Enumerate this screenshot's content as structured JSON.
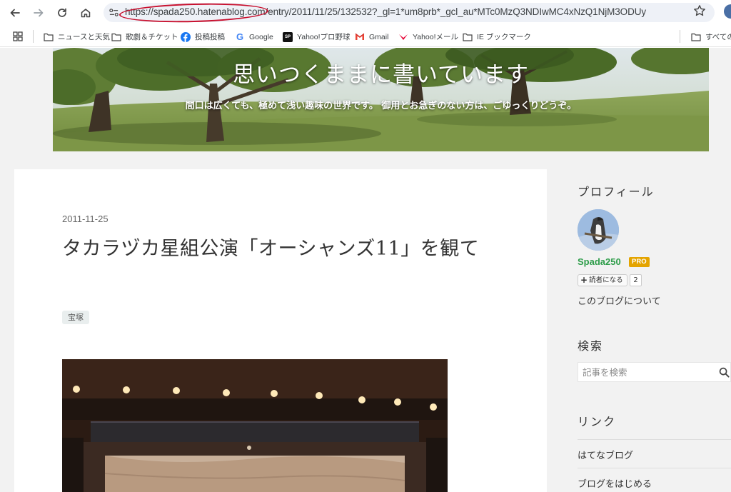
{
  "browser": {
    "url": "https://spada250.hatenablog.com/entry/2011/11/25/132532?_gl=1*um8prb*_gcl_au*MTc0MzQ3NDIwMC4xNzQ1NjM3ODUy",
    "icons": [
      "back-arrow-icon",
      "forward-arrow-icon",
      "reload-icon",
      "home-icon",
      "site-info-icon",
      "bookmark-star-icon"
    ],
    "annotation_color": "#c8102e"
  },
  "bookmarks": [
    {
      "label": "ニュースと天気",
      "icon": "folder-icon"
    },
    {
      "label": "歌劇＆チケット",
      "icon": "folder-icon"
    },
    {
      "label": "投稿投稿",
      "icon": "facebook-icon"
    },
    {
      "label": "Google",
      "icon": "google-icon"
    },
    {
      "label": "Yahoo!プロ野球",
      "icon": "sports-icon"
    },
    {
      "label": "Gmail",
      "icon": "gmail-icon"
    },
    {
      "label": "Yahoo!メール",
      "icon": "yahoo-mail-icon"
    },
    {
      "label": "IE ブックマーク",
      "icon": "folder-icon"
    },
    {
      "label": "すべての",
      "icon": "folder-icon"
    }
  ],
  "blog": {
    "title": "思いつくままに書いています",
    "description": "間口は広くても、極めて浅い趣味の世界です。 御用とお急ぎのない方は、ごゆっくりどうぞ。"
  },
  "entry": {
    "date": "2011-11-25",
    "title": "タカラヅカ星組公演「オーシャンズ11」を観て",
    "category": "宝塚"
  },
  "sidebar": {
    "profile_heading": "プロフィール",
    "user_name": "Spada250",
    "pro_label": "PRO",
    "subscribe_label": "読者になる",
    "subscriber_count": "2",
    "about_link": "このブログについて",
    "search_heading": "検索",
    "search_placeholder": "記事を検索",
    "links_heading": "リンク",
    "links": [
      "はてなブログ",
      "ブログをはじめる"
    ]
  },
  "colors": {
    "user_name": "#2e9d4a",
    "pro_badge": "#e4a400",
    "page_background": "#f2f2f2"
  }
}
